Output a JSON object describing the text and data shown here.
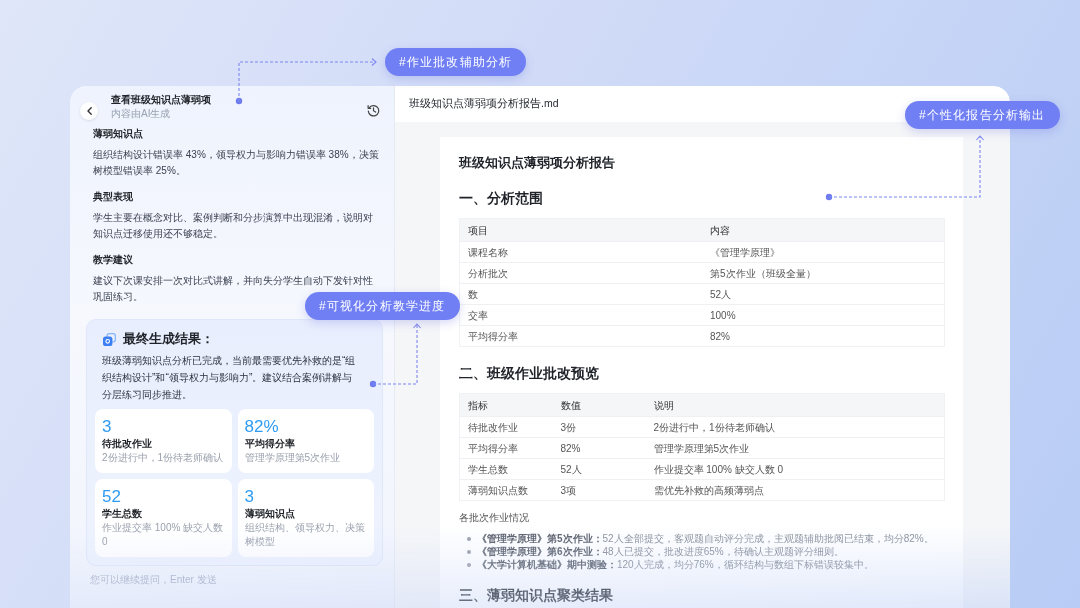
{
  "callouts": [
    {
      "text": "#作业批改辅助分析"
    },
    {
      "text": "#个性化报告分析输出"
    },
    {
      "text": "#可视化分析教学进度"
    }
  ],
  "chat_panel": {
    "title": "查看班级知识点薄弱项",
    "subtitle": "内容由AI生成",
    "sections": [
      {
        "heading": "薄弱知识点",
        "text": "组织结构设计错误率 43%，领导权力与影响力错误率 38%，决策树模型错误率 25%。"
      },
      {
        "heading": "典型表现",
        "text": "学生主要在概念对比、案例判断和分步演算中出现混淆，说明对知识点迁移使用还不够稳定。"
      },
      {
        "heading": "教学建议",
        "text": "建议下次课安排一次对比式讲解，并向失分学生自动下发针对性巩固练习。"
      }
    ],
    "result": {
      "title": "最终生成结果：",
      "text": "班级薄弱知识点分析已完成，当前最需要优先补救的是“组织结构设计”和“领导权力与影响力”。建议结合案例讲解与分层练习同步推进。",
      "stats": [
        {
          "value": "3",
          "label": "待批改作业",
          "note": "2份进行中，1份待老师确认"
        },
        {
          "value": "82%",
          "label": "平均得分率",
          "note": "管理学原理第5次作业"
        },
        {
          "value": "52",
          "label": "学生总数",
          "note": "作业提交率 100% 缺交人数 0"
        },
        {
          "value": "3",
          "label": "薄弱知识点",
          "note": "组织结构、领导权力、决策树模型"
        }
      ]
    },
    "input": {
      "placeholder": "您可以继续提问，Enter 发送"
    }
  },
  "report": {
    "file_name": "班级知识点薄弱项分析报告.md",
    "title": "班级知识点薄弱项分析报告",
    "sections": [
      {
        "heading": "一、分析范围",
        "table": {
          "columns": [
            "项目",
            "内容"
          ],
          "rows": [
            [
              "课程名称",
              "《管理学原理》"
            ],
            [
              "分析批次",
              "第5次作业（班级全量）"
            ],
            [
              "数",
              "52人"
            ],
            [
              "交率",
              "100%"
            ],
            [
              "平均得分率",
              "82%"
            ]
          ]
        }
      },
      {
        "heading": "二、班级作业批改预览",
        "table": {
          "columns": [
            "指标",
            "数值",
            "说明"
          ],
          "rows": [
            [
              "待批改作业",
              "3份",
              "2份进行中，1份待老师确认"
            ],
            [
              "平均得分率",
              "82%",
              "管理学原理第5次作业"
            ],
            [
              "学生总数",
              "52人",
              "作业提交率 100% 缺交人数 0"
            ],
            [
              "薄弱知识点数",
              "3项",
              "需优先补救的高频薄弱点"
            ]
          ]
        },
        "subheading": "各批次作业情况",
        "bullets": [
          "**《管理学原理》第5次作业：**52人全部提交，客观题自动评分完成，主观题辅助批阅已结束，均分82%。",
          "**《管理学原理》第6次作业：**48人已提交，批改进度65%，待确认主观题评分细则。",
          "**《大学计算机基础》期中测验：**120人完成，均分76%，循环结构与数组下标错误较集中。"
        ]
      },
      {
        "heading": "三、薄弱知识点聚类结果"
      }
    ]
  }
}
